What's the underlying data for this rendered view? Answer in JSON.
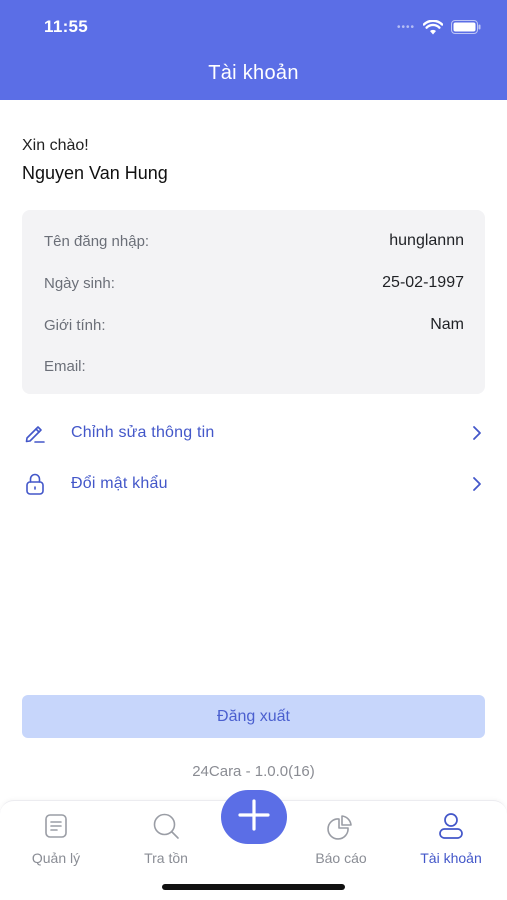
{
  "status_bar": {
    "time": "11:55",
    "signal_icon": "signal-dots-icon",
    "wifi_icon": "wifi-icon",
    "battery_icon": "battery-icon"
  },
  "header": {
    "title": "Tài khoản"
  },
  "profile": {
    "greeting": "Xin chào!",
    "name": "Nguyen Van Hung"
  },
  "info": {
    "rows": [
      {
        "label": "Tên đăng nhập:",
        "value": "hunglannn"
      },
      {
        "label": "Ngày sinh:",
        "value": "25-02-1997"
      },
      {
        "label": "Giới tính:",
        "value": "Nam"
      },
      {
        "label": "Email:",
        "value": ""
      }
    ]
  },
  "menu": {
    "items": [
      {
        "label": "Chỉnh sửa thông tin",
        "icon": "pencil-icon"
      },
      {
        "label": "Đổi mật khẩu",
        "icon": "lock-icon"
      }
    ]
  },
  "actions": {
    "logout_label": "Đăng xuất"
  },
  "app": {
    "version": "24Cara - 1.0.0(16)"
  },
  "tabbar": {
    "tabs": [
      {
        "label": "Quản lý",
        "icon": "list-document-icon",
        "active": false
      },
      {
        "label": "Tra tồn",
        "icon": "search-icon",
        "active": false
      },
      {
        "label": "",
        "icon": "plus-icon",
        "active": false
      },
      {
        "label": "Báo cáo",
        "icon": "pie-chart-icon",
        "active": false
      },
      {
        "label": "Tài khoản",
        "icon": "user-icon",
        "active": true
      }
    ]
  },
  "colors": {
    "primary": "#5b6ee6",
    "link": "#4357c9",
    "card_bg": "#f3f3f5",
    "logout_bg": "#c7d6fb"
  }
}
